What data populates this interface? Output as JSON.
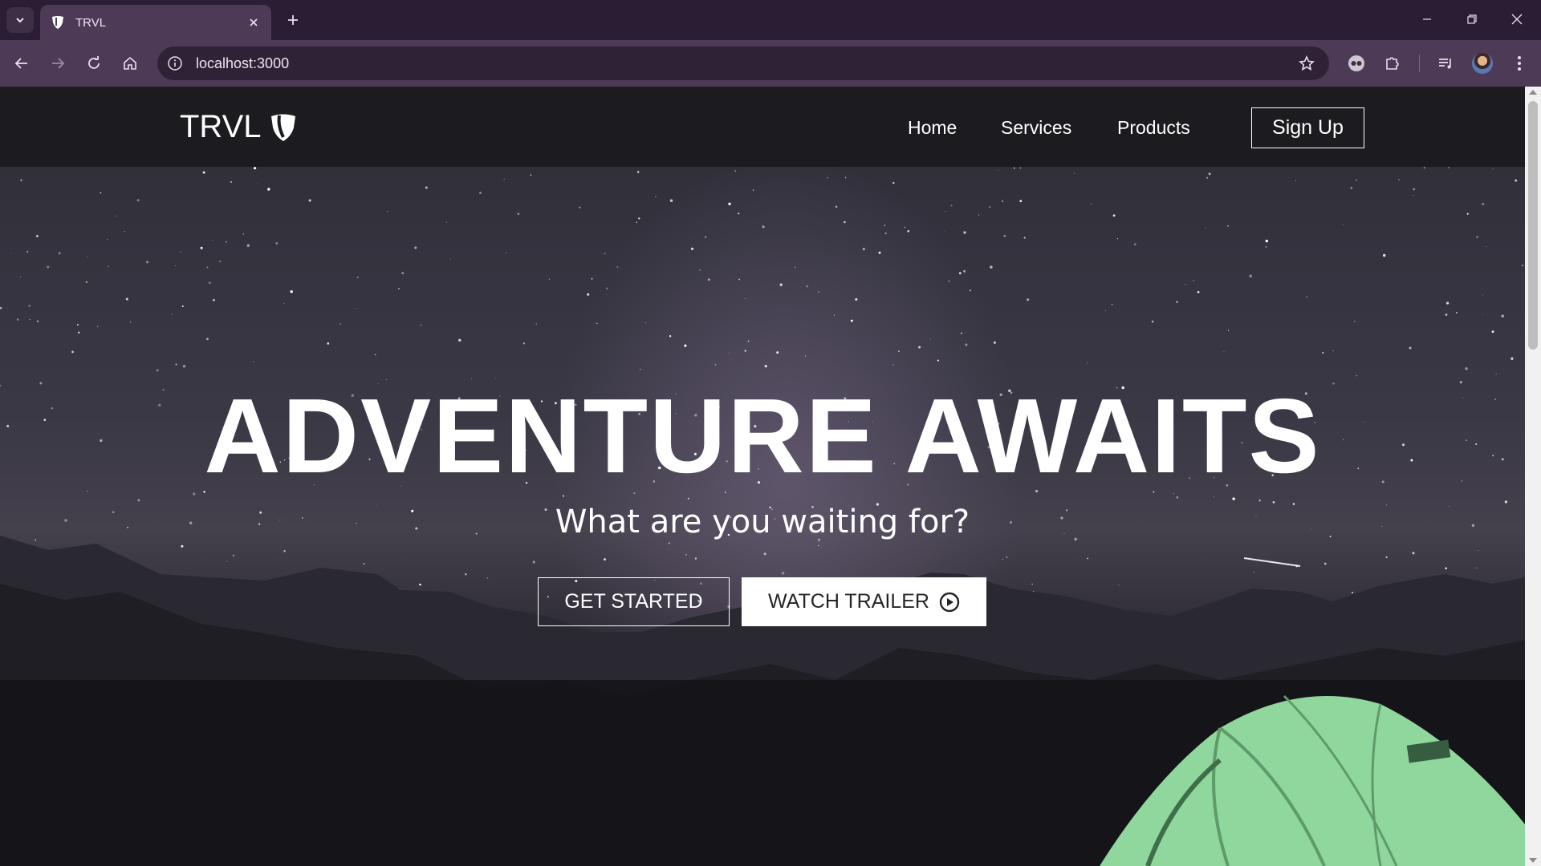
{
  "browser": {
    "tab": {
      "title": "TRVL",
      "favicon": "shield-logo-icon"
    },
    "address_bar": {
      "url": "localhost:3000"
    },
    "icons": [
      "tab-list-icon",
      "close-tab-icon",
      "new-tab-icon",
      "minimize-icon",
      "restore-icon",
      "close-window-icon",
      "back-icon",
      "forward-icon",
      "reload-icon",
      "home-icon",
      "site-info-icon",
      "bookmark-star-icon",
      "extension-avatar-icon",
      "puzzle-icon",
      "media-control-icon",
      "profile-avatar",
      "menu-dots-icon"
    ]
  },
  "site": {
    "brand": {
      "name": "TRVL",
      "logo": "shield-logo-icon"
    },
    "nav": {
      "links": [
        {
          "label": "Home"
        },
        {
          "label": "Services"
        },
        {
          "label": "Products"
        }
      ],
      "signup_label": "Sign Up"
    },
    "hero": {
      "title": "ADVENTURE AWAITS",
      "subtitle": "What are you waiting for?",
      "primary_button": "GET STARTED",
      "secondary_button": "WATCH TRAILER",
      "secondary_icon": "play-circle-icon"
    }
  },
  "colors": {
    "chrome_tabbar": "#2b1d33",
    "chrome_toolbar": "#4d3a57",
    "site_nav_bg": "#1c1b1f",
    "tent": "#8fd79c",
    "text": "#ffffff"
  }
}
